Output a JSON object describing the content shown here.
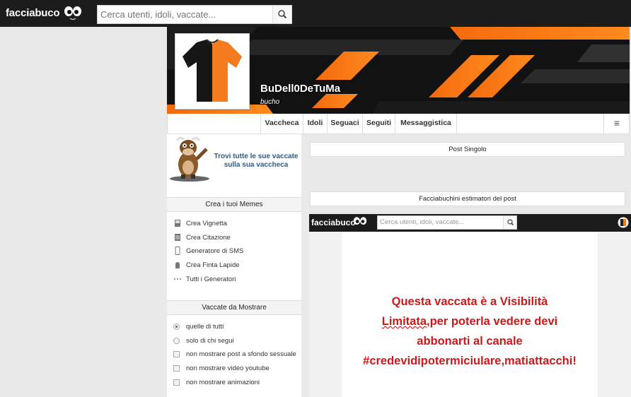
{
  "header": {
    "logo_text": "facciabuco",
    "search_placeholder": "Cerca utenti, idoli, vaccate...",
    "search_icon": "magnifier-icon"
  },
  "profile": {
    "username": "BuDell0DeTuMa",
    "subtitle": "bucho"
  },
  "nav": {
    "items": [
      "Vaccheca",
      "Idoli",
      "Seguaci",
      "Seguiti",
      "Messaggistica"
    ],
    "menu_icon": "≡"
  },
  "sidebar": {
    "promo_text": "Trovi tutte le sue vaccate sulla sua vaccheca",
    "memes_title": "Crea i tuoi Memes",
    "memes_items": [
      {
        "label": "Crea Vignetta",
        "icon": "vignetta-icon"
      },
      {
        "label": "Crea Citazione",
        "icon": "citazione-icon"
      },
      {
        "label": "Generatore di SMS",
        "icon": "phone-icon"
      },
      {
        "label": "Crea Finta Lapide",
        "icon": "tombstone-icon"
      },
      {
        "label": "Tutti i Generatori",
        "icon": "dots-icon"
      }
    ],
    "filter_title": "Vaccate da Mostrare",
    "filter_radios": [
      {
        "label": "quelle di tutti",
        "checked": true
      },
      {
        "label": "solo di chi segui",
        "checked": false
      }
    ],
    "filter_checks": [
      {
        "label": "non mostrare post a sfondo sessuale",
        "checked": false
      },
      {
        "label": "non mostrare video youtube",
        "checked": false
      },
      {
        "label": "non mostrare animazioni",
        "checked": false
      }
    ]
  },
  "main": {
    "post_single_label": "Post Singolo",
    "estimators_label": "Facciabuchini estimatori del post"
  },
  "embed": {
    "logo_text": "facciabuco",
    "search_placeholder": "Cerca utenti, idoli, vaccate...",
    "message_line1": "Questa vaccata è a Visibilità",
    "message_line2_a": "Limitata",
    "message_line2_b": ",per poterla vedere devi",
    "message_line3": "abbonarti al canale",
    "message_line4": "#credevidipotermiciulare,matiattacchi!"
  },
  "colors": {
    "topbar": "#1c1c1c",
    "accent_orange": "#f26a10",
    "link_blue": "#2c5c8f",
    "warning_red": "#cc1a1a"
  }
}
